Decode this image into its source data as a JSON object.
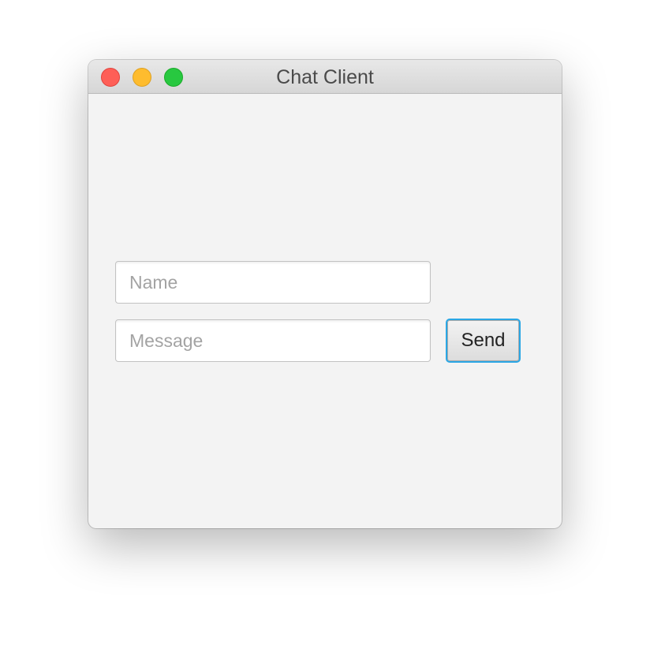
{
  "window": {
    "title": "Chat Client",
    "controls": {
      "close_color": "#fe5f57",
      "minimize_color": "#febc2e",
      "zoom_color": "#28c840"
    }
  },
  "form": {
    "name_placeholder": "Name",
    "message_placeholder": "Message",
    "send_label": "Send",
    "focus_color": "#2aa7e5"
  }
}
